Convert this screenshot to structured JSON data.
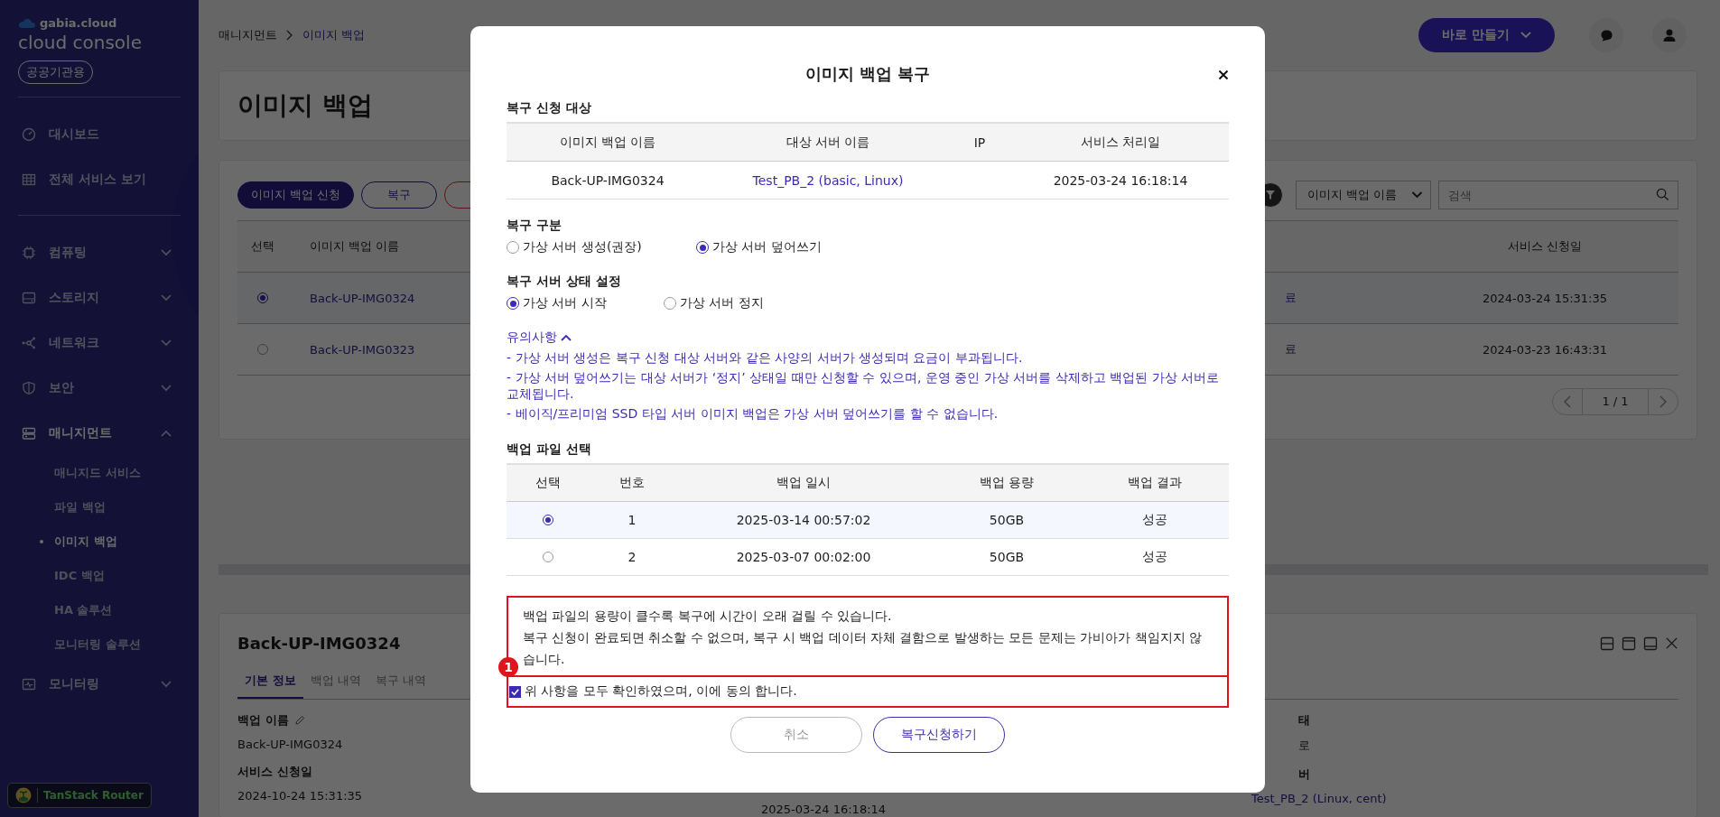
{
  "sidebar": {
    "brand": "gabia.cloud",
    "product": "cloud console",
    "badge": "공공기관용",
    "top_items": [
      {
        "label": "대시보드"
      },
      {
        "label": "전체 서비스 보기"
      }
    ],
    "groups": [
      {
        "label": "컴퓨팅",
        "expanded": false
      },
      {
        "label": "스토리지",
        "expanded": false
      },
      {
        "label": "네트워크",
        "expanded": false
      },
      {
        "label": "보안",
        "expanded": false
      },
      {
        "label": "매니지먼트",
        "expanded": true,
        "children": [
          {
            "label": "매니지드 서비스",
            "selected": false
          },
          {
            "label": "파일 백업",
            "selected": false
          },
          {
            "label": "이미지 백업",
            "selected": true
          },
          {
            "label": "IDC 백업",
            "selected": false
          },
          {
            "label": "HA 솔루션",
            "selected": false
          },
          {
            "label": "모니터링 솔루션",
            "selected": false
          }
        ]
      },
      {
        "label": "모니터링",
        "expanded": false
      }
    ]
  },
  "devtools_button": {
    "label": "TanStack Router"
  },
  "topbar": {
    "breadcrumb": [
      "매니지먼트",
      "이미지 백업"
    ],
    "create_button": "바로 만들기"
  },
  "page_title": "이미지 백업",
  "toolbar": {
    "buttons": [
      {
        "kind": "primary",
        "label": "이미지 백업 신청"
      },
      {
        "kind": "outline",
        "label": "복구"
      },
      {
        "kind": "danger"
      }
    ],
    "select": "이미지 백업 이름",
    "search": {
      "placeholder": "검색"
    }
  },
  "table": {
    "columns": [
      "선택",
      "이미지 백업 이름",
      "서비스 신청일"
    ],
    "rows": [
      {
        "selected": true,
        "name": "Back-UP-IMG0324",
        "column_3": "료",
        "date": "2024-03-24 15:31:35"
      },
      {
        "selected": false,
        "name": "Back-UP-IMG0323",
        "column_3": "료",
        "date": "2024-03-23 16:43:31"
      }
    ]
  },
  "pagination": "1 / 1",
  "detail": {
    "title": "Back-UP-IMG0324",
    "tabs": [
      {
        "label": "기본 정보",
        "selected": true
      },
      {
        "label": "백업 내역",
        "selected": false
      },
      {
        "label": "복구 내역",
        "selected": false
      }
    ],
    "left": [
      {
        "label": "백업 이름",
        "editable": true,
        "value": "Back-UP-IMG0324"
      },
      {
        "label": "서비스 신청일",
        "editable": false,
        "value": "2024-10-24 15:31:35"
      }
    ],
    "middle_value": "2025-03-24 16:18:14",
    "right": [
      {
        "label": "태",
        "value": "로"
      },
      {
        "label": "버",
        "value": "Test_PB_2 (Linux, cent)"
      }
    ]
  },
  "modal": {
    "title": "이미지 백업 복구",
    "target_heading": "복구 신청 대상",
    "target_columns": [
      "이미지 백업 이름",
      "대상 서버 이름",
      "IP",
      "서비스 처리일"
    ],
    "target_row": {
      "backup_name": "Back-UP-IMG0324",
      "server_name": "Test_PB_2 (basic, Linux)",
      "service_date": "2025-03-24 16:18:14"
    },
    "restore_type": {
      "heading": "복구 구분",
      "options": [
        {
          "label": "가상 서버 생성(권장)",
          "selected": false
        },
        {
          "label": "가상 서버 덮어쓰기",
          "selected": true
        }
      ]
    },
    "server_state": {
      "heading": "복구 서버 상태 설정",
      "options": [
        {
          "label": "가상 서버 시작",
          "selected": true
        },
        {
          "label": "가상 서버 정지",
          "selected": false
        }
      ]
    },
    "notes": {
      "title": "유의사항",
      "expanded": true,
      "lines": [
        "- 가상 서버 생성은 복구 신청 대상 서버와 같은 사양의 서버가 생성되며 요금이 부과됩니다.",
        "- 가상 서버 덮어쓰기는 대상 서버가 ‘정지’ 상태일 때만 신청할 수 있으며, 운영 중인 가상 서버를 삭제하고 백업된 가상 서버로 교체됩니다.",
        "- 베이직/프리미엄 SSD 타입 서버 이미지 백업은 가상 서버 덮어쓰기를 할 수 없습니다."
      ]
    },
    "file_heading": "백업 파일 선택",
    "file_columns": [
      "선택",
      "번호",
      "백업 일시",
      "백업 용량",
      "백업 결과"
    ],
    "files": [
      {
        "selected": true,
        "number": "1",
        "date": "2025-03-14 00:57:02",
        "size": "50GB",
        "result": "성공"
      },
      {
        "selected": false,
        "number": "2",
        "date": "2025-03-07 00:02:00",
        "size": "50GB",
        "result": "성공"
      }
    ],
    "warning_lines": [
      "백업 파일의 용량이 클수록 복구에 시간이 오래 걸릴 수 있습니다.",
      "복구 신청이 완료되면 취소할 수 없으며, 복구 시 백업 데이터 자체 결함으로 발생하는 모든 문제는 가비아가 책임지지 않습니다."
    ],
    "agree": {
      "label": "위 사항을 모두 확인하였으며, 이에 동의 합니다.",
      "checked": true
    },
    "annotation": "1",
    "cancel_button": {
      "label": "취소",
      "disabled": true
    },
    "submit_button": {
      "label": "복구신청하기",
      "disabled": false
    }
  }
}
